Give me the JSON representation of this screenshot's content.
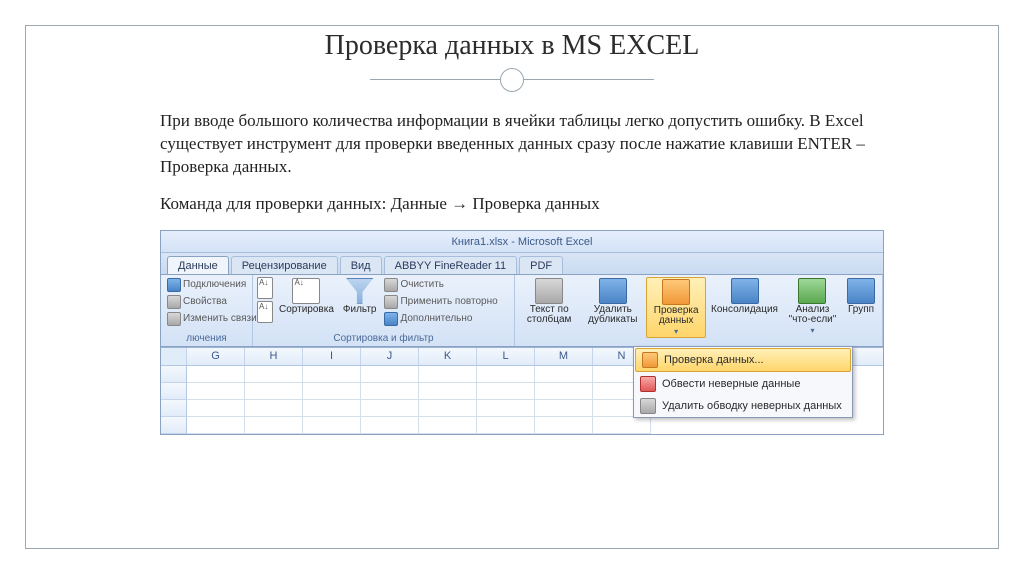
{
  "slide": {
    "title": "Проверка данных в MS EXCEL",
    "para1": "При вводе большого количества информации в ячейки таблицы  легко допустить ошибку. В Excel  существует инструмент для проверки введенных данных  сразу после нажатие клавиши  ENTER – Проверка данных.",
    "para2": "Команда для проверки данных: Данные →  Проверка данных"
  },
  "excel": {
    "title": "Книга1.xlsx  -  Microsoft Excel",
    "tabs": [
      "Данные",
      "Рецензирование",
      "Вид",
      "ABBYY FineReader 11",
      "PDF"
    ],
    "active_tab": 0,
    "group_connections": {
      "items": [
        "Подключения",
        "Свойства",
        "Изменить связи"
      ],
      "label": "лючения"
    },
    "group_sort": {
      "sort_btn": "Сортировка",
      "filter_btn": "Фильтр",
      "clear": "Очистить",
      "reapply": "Применить повторно",
      "advanced": "Дополнительно",
      "label": "Сортировка и фильтр"
    },
    "group_tools": {
      "text_to_cols": "Текст по столбцам",
      "remove_dup": "Удалить дубликаты",
      "validation": "Проверка данных",
      "consolidate": "Консолидация",
      "whatif": "Анализ \"что-если\"",
      "group": "Групп"
    },
    "dropdown": {
      "item1": "Проверка данных...",
      "item2": "Обвести неверные данные",
      "item3": "Удалить обводку неверных данных"
    },
    "columns": [
      "G",
      "H",
      "I",
      "J",
      "K",
      "L",
      "M",
      "N"
    ]
  }
}
